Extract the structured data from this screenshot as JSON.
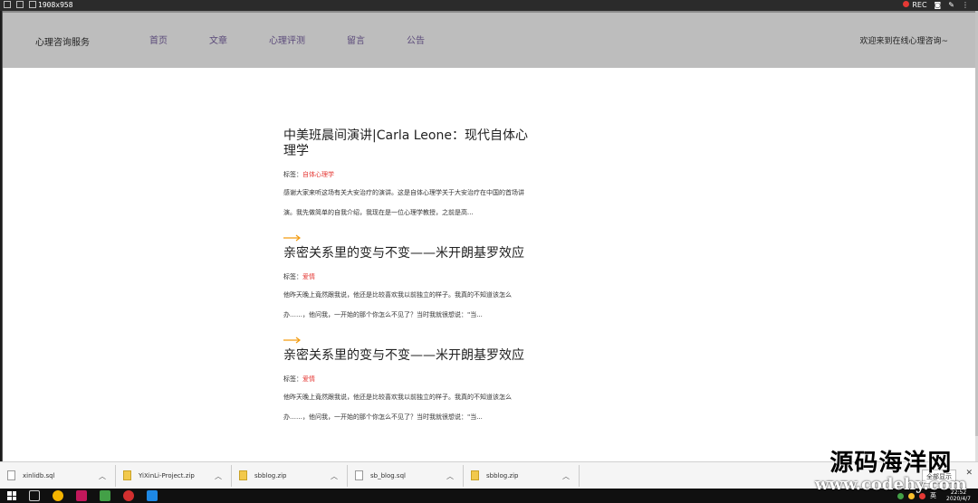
{
  "recorder": {
    "resolution": "1908x958",
    "rec_label": "REC"
  },
  "navbar": {
    "brand": "心理咨询服务",
    "links": [
      "首页",
      "文章",
      "心理评测",
      "留言",
      "公告"
    ],
    "welcome": "欢迎来到在线心理咨询~"
  },
  "posts": [
    {
      "title": "中美班晨间演讲|Carla Leone：现代自体心理学",
      "tag_label": "标签：",
      "tag": "自体心理学",
      "excerpt": "感谢大家来听这场有关大安治疗的演讲。这是自体心理学关于大安治疗在中国的首场讲演。我先做简单的自我介绍，我现在是一位心理学教授，之前是高..."
    },
    {
      "title": "亲密关系里的变与不变——米开朗基罗效应",
      "tag_label": "标签：",
      "tag": "爱情",
      "excerpt": "他昨天晚上竟然跟我说，他还是比较喜欢我以前独立的样子。我真的不知道该怎么办……，他问我，一开始的那个你怎么不见了？当时我就很想说：\"当..."
    },
    {
      "title": "亲密关系里的变与不变——米开朗基罗效应",
      "tag_label": "标签：",
      "tag": "爱情",
      "excerpt": "他昨天晚上竟然跟我说，他还是比较喜欢我以前独立的样子。我真的不知道该怎么办……，他问我，一开始的那个你怎么不见了？当时我就很想说：\"当..."
    }
  ],
  "downloads": {
    "items": [
      {
        "name": "xinlidb.sql",
        "type": "sql"
      },
      {
        "name": "YiXinLi-Project.zip",
        "type": "zip"
      },
      {
        "name": "sbblog.zip",
        "type": "zip"
      },
      {
        "name": "sb_blog.sql",
        "type": "sql"
      },
      {
        "name": "sbblog.zip",
        "type": "zip"
      }
    ],
    "show_all": "全部显示"
  },
  "taskbar": {
    "time": "22:52",
    "date": "2020/4/7",
    "lang": "英"
  },
  "watermark": {
    "line1": "源码海洋网",
    "line2": "www.codehy.com"
  },
  "colors": {
    "navbar": "#bdbdbd",
    "tag": "#e53935",
    "arrow": "#f39c12",
    "nav_link": "#5b4a7a"
  }
}
